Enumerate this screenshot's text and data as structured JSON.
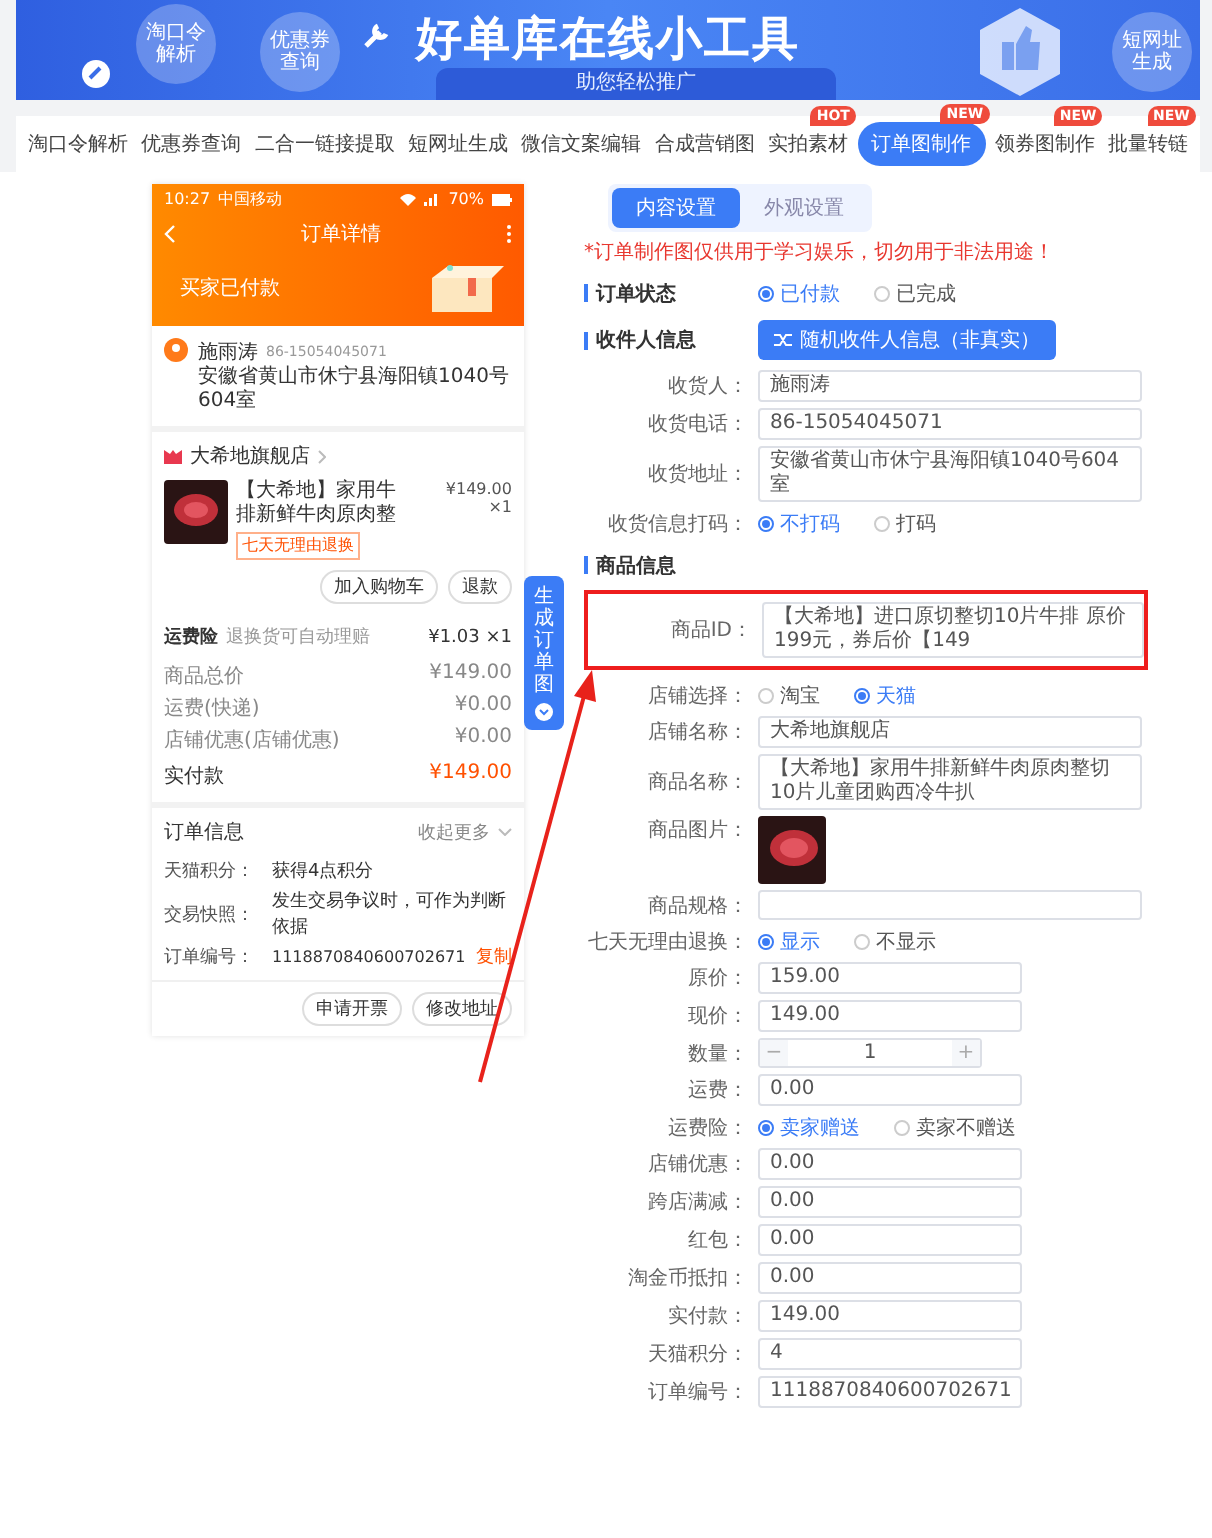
{
  "banner": {
    "title": "好单库在线小工具",
    "subtitle": "助您轻松推广",
    "bubbles": [
      "淘口令解析",
      "优惠券查询",
      "短网址生成"
    ]
  },
  "nav": [
    {
      "label": "淘口令解析",
      "selected": false
    },
    {
      "label": "优惠券查询",
      "selected": false
    },
    {
      "label": "二合一链接提取",
      "selected": false
    },
    {
      "label": "短网址生成",
      "selected": false
    },
    {
      "label": "微信文案编辑",
      "selected": false
    },
    {
      "label": "合成营销图",
      "selected": false
    },
    {
      "label": "实拍素材",
      "badge": "HOT",
      "selected": false
    },
    {
      "label": "订单图制作",
      "badge": "NEW",
      "selected": true
    },
    {
      "label": "领券图制作",
      "badge": "NEW",
      "selected": false
    },
    {
      "label": "批量转链",
      "badge": "NEW",
      "selected": false
    }
  ],
  "preview": {
    "status_bar": {
      "time": "10:27",
      "carrier": "中国移动",
      "battery": "70%"
    },
    "title": "订单详情",
    "status": "买家已付款",
    "receiver": {
      "name": "施雨涛",
      "phone": "86-15054045071",
      "address": "安徽省黄山市休宁县海阳镇1040号604室"
    },
    "shop": "大希地旗舰店",
    "product": {
      "name": "【大希地】家用牛排新鲜牛肉原肉整",
      "tag": "七天无理由退换",
      "price": "¥149.00",
      "qty": "×1"
    },
    "item_buttons": [
      "加入购物车",
      "退款"
    ],
    "insurance": {
      "label": "运费险",
      "desc": "退换货可自动理赔",
      "price": "¥1.03 ×1"
    },
    "summary": [
      {
        "label": "商品总价",
        "value": "¥149.00"
      },
      {
        "label": "运费(快递)",
        "value": "¥0.00"
      },
      {
        "label": "店铺优惠(店铺优惠)",
        "value": "¥0.00"
      }
    ],
    "paid": {
      "label": "实付款",
      "value": "¥149.00"
    },
    "order_info": {
      "title": "订单信息",
      "more": "收起更多",
      "rows": [
        {
          "label": "天猫积分：",
          "value": "获得4点积分"
        },
        {
          "label": "交易快照：",
          "value": "发生交易争议时，可作为判断依据"
        },
        {
          "label": "订单编号：",
          "value": "1118870840600702671",
          "action": "复制"
        }
      ]
    },
    "bottom_buttons": [
      "申请开票",
      "修改地址"
    ]
  },
  "generate_button": "生成订单图",
  "form": {
    "tabs": [
      {
        "label": "内容设置",
        "selected": true
      },
      {
        "label": "外观设置",
        "selected": false
      }
    ],
    "notice": "*订单制作图仅供用于学习娱乐，切勿用于非法用途！",
    "rows": [
      {
        "kind": "section-radio",
        "label": "订单状态",
        "options": [
          {
            "label": "已付款",
            "selected": true
          },
          {
            "label": "已完成",
            "selected": false
          }
        ]
      },
      {
        "kind": "section-button",
        "label": "收件人信息",
        "button": "随机收件人信息（非真实）"
      },
      {
        "kind": "field",
        "label": "收货人：",
        "value": "施雨涛",
        "highlighted": false
      },
      {
        "kind": "field",
        "label": "收货电话：",
        "value": "86-15054045071",
        "highlighted": false
      },
      {
        "kind": "field",
        "label": "收货地址：",
        "value": "安徽省黄山市休宁县海阳镇1040号604室",
        "highlighted": false
      },
      {
        "kind": "radio",
        "label": "收货信息打码：",
        "options": [
          {
            "label": "不打码",
            "selected": true
          },
          {
            "label": "打码",
            "selected": false
          }
        ]
      },
      {
        "kind": "section",
        "label": "商品信息"
      },
      {
        "kind": "field",
        "label": "商品ID：",
        "value": "【大希地】进口原切整切10片牛排 原价199元，券后价【149",
        "highlighted": true
      },
      {
        "kind": "radio",
        "label": "店铺选择：",
        "options": [
          {
            "label": "淘宝",
            "selected": false
          },
          {
            "label": "天猫",
            "selected": true
          }
        ]
      },
      {
        "kind": "field",
        "label": "店铺名称：",
        "value": "大希地旗舰店",
        "highlighted": false
      },
      {
        "kind": "field",
        "label": "商品名称：",
        "value": "【大希地】家用牛排新鲜牛肉原肉整切10片儿童团购西冷牛扒",
        "highlighted": false
      },
      {
        "kind": "image",
        "label": "商品图片："
      },
      {
        "kind": "field",
        "label": "商品规格：",
        "highlighted": false
      },
      {
        "kind": "radio",
        "label": "七天无理由退换：",
        "options": [
          {
            "label": "显示",
            "selected": true
          },
          {
            "label": "不显示",
            "selected": false
          }
        ]
      },
      {
        "kind": "short",
        "label": "原价：",
        "value": "159.00",
        "highlighted": false
      },
      {
        "kind": "short",
        "label": "现价：",
        "value": "149.00",
        "highlighted": false
      },
      {
        "kind": "stepper",
        "label": "数量：",
        "value": "1",
        "minus": "−",
        "plus": "+"
      },
      {
        "kind": "short",
        "label": "运费：",
        "value": "0.00",
        "highlighted": false
      },
      {
        "kind": "radio",
        "label": "运费险：",
        "options": [
          {
            "label": "卖家赠送",
            "selected": true
          },
          {
            "label": "卖家不赠送",
            "selected": false
          }
        ]
      },
      {
        "kind": "short",
        "label": "店铺优惠：",
        "value": "0.00",
        "highlighted": false
      },
      {
        "kind": "short",
        "label": "跨店满减：",
        "value": "0.00",
        "highlighted": false
      },
      {
        "kind": "short",
        "label": "红包：",
        "value": "0.00",
        "highlighted": false
      },
      {
        "kind": "short",
        "label": "淘金币抵扣：",
        "value": "0.00",
        "highlighted": false
      },
      {
        "kind": "short",
        "label": "实付款：",
        "value": "149.00",
        "highlighted": false
      },
      {
        "kind": "short",
        "label": "天猫积分：",
        "value": "4",
        "highlighted": false
      },
      {
        "kind": "short",
        "label": "订单编号：",
        "value": "1118870840600702671",
        "highlighted": false
      }
    ]
  }
}
